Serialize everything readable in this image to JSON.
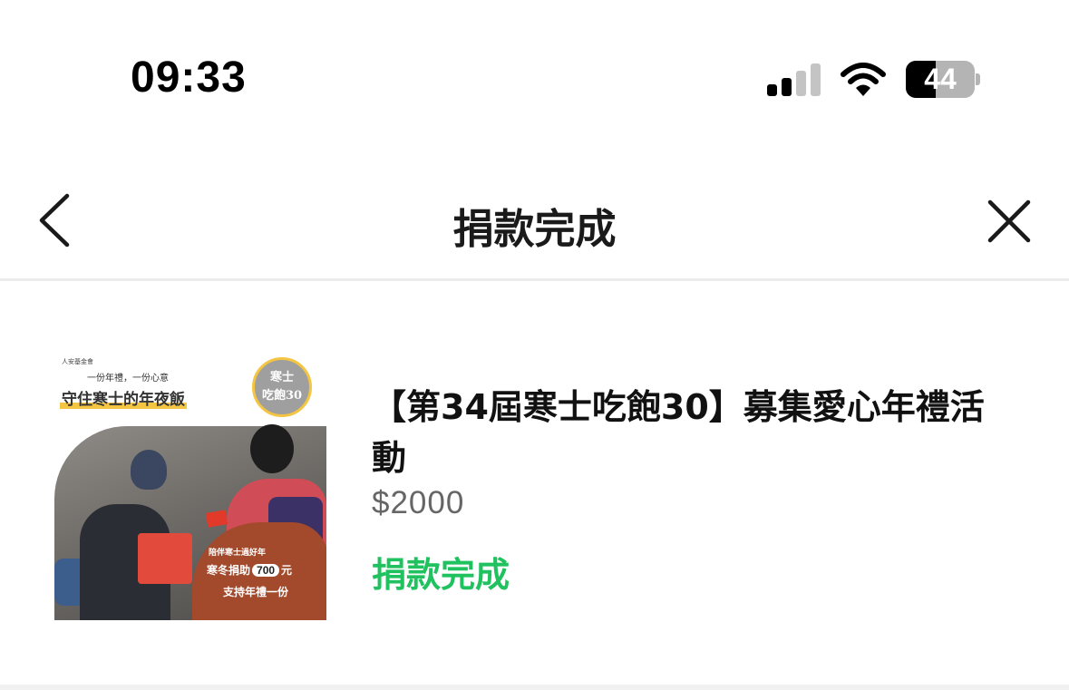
{
  "status_bar": {
    "time": "09:33",
    "signal_icon": "cellular-signal-icon",
    "wifi_icon": "wifi-icon",
    "battery_level": "44",
    "battery_fraction": 0.44
  },
  "nav": {
    "title": "捐款完成",
    "back_icon": "chevron-left-icon",
    "close_icon": "close-icon"
  },
  "donation": {
    "title": "【第34屆寒士吃飽30】募集愛心年禮活動",
    "amount": "$2000",
    "status": "捐款完成",
    "status_color": "#1fc25e",
    "thumbnail": {
      "org": "人安基金會",
      "tagline": "一份年禮，一份心意",
      "headline": "守住寒士的年夜飯",
      "badge_line1": "寒士",
      "badge_line2": "吃飽30",
      "panel_line1": "陪伴寒士過好年",
      "panel_line2_prefix": "寒冬捐助",
      "panel_amount": "700",
      "panel_line2_suffix": "元",
      "panel_line3": "支持年禮一份"
    }
  }
}
